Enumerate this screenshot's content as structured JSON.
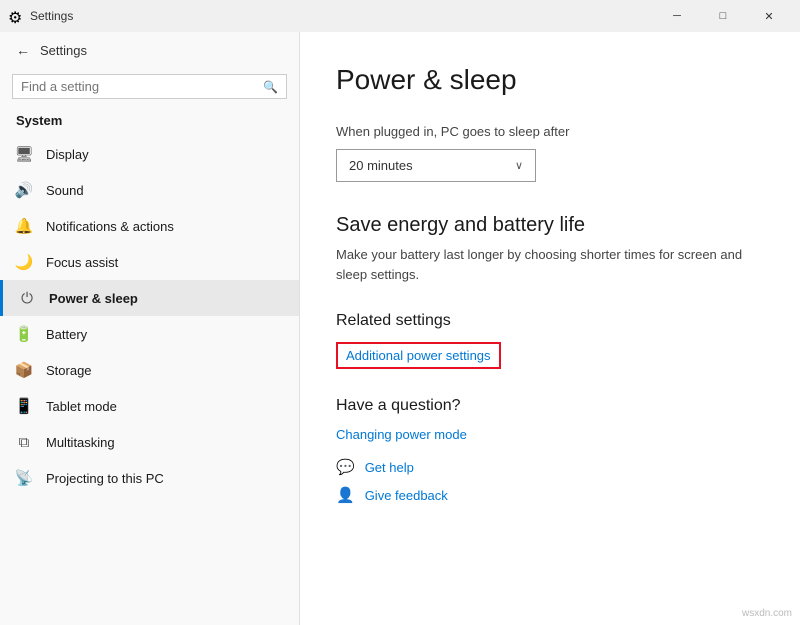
{
  "titlebar": {
    "title": "Settings",
    "min_label": "─",
    "max_label": "□",
    "close_label": "✕"
  },
  "sidebar": {
    "back_label": "Settings",
    "search_placeholder": "Find a setting",
    "section_label": "System",
    "nav_items": [
      {
        "id": "display",
        "icon": "🖥",
        "label": "Display"
      },
      {
        "id": "sound",
        "icon": "🔊",
        "label": "Sound"
      },
      {
        "id": "notifications",
        "icon": "🔔",
        "label": "Notifications & actions"
      },
      {
        "id": "focus",
        "icon": "🌙",
        "label": "Focus assist"
      },
      {
        "id": "power",
        "icon": "⏻",
        "label": "Power & sleep",
        "active": true
      },
      {
        "id": "battery",
        "icon": "🔋",
        "label": "Battery"
      },
      {
        "id": "storage",
        "icon": "📦",
        "label": "Storage"
      },
      {
        "id": "tablet",
        "icon": "📱",
        "label": "Tablet mode"
      },
      {
        "id": "multitasking",
        "icon": "⧉",
        "label": "Multitasking"
      },
      {
        "id": "projecting",
        "icon": "📡",
        "label": "Projecting to this PC"
      }
    ]
  },
  "content": {
    "page_title": "Power & sleep",
    "sleep_label": "When plugged in, PC goes to sleep after",
    "sleep_value": "20 minutes",
    "energy_title": "Save energy and battery life",
    "energy_desc": "Make your battery last longer by choosing shorter times for screen and sleep settings.",
    "related_title": "Related settings",
    "additional_power_link": "Additional power settings",
    "question_title": "Have a question?",
    "question_link": "Changing power mode",
    "help_items": [
      {
        "icon": "💬",
        "label": "Get help"
      },
      {
        "icon": "👤",
        "label": "Give feedback"
      }
    ]
  },
  "watermark": "wsxdn.com"
}
